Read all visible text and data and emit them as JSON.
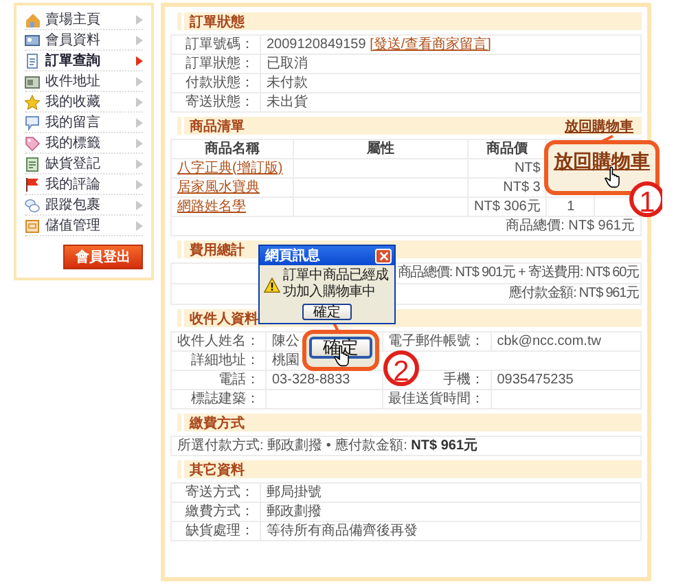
{
  "sidebar": {
    "items": [
      {
        "label": "賣場主頁",
        "selected": false
      },
      {
        "label": "會員資料",
        "selected": false
      },
      {
        "label": "訂單查詢",
        "selected": true
      },
      {
        "label": "收件地址",
        "selected": false
      },
      {
        "label": "我的收藏",
        "selected": false
      },
      {
        "label": "我的留言",
        "selected": false
      },
      {
        "label": "我的標籤",
        "selected": false
      },
      {
        "label": "缺貨登記",
        "selected": false
      },
      {
        "label": "我的評論",
        "selected": false
      },
      {
        "label": "跟蹤包裹",
        "selected": false
      },
      {
        "label": "儲值管理",
        "selected": false
      }
    ],
    "logout_button": "會員登出"
  },
  "sections": [
    {
      "kind": "fields",
      "title": "訂單狀態",
      "rows": [
        {
          "label": "訂單號碼：",
          "value": "2009120849159",
          "link": "[發送/查看商家留言]"
        },
        {
          "label": "訂單狀態：",
          "value": "已取消"
        },
        {
          "label": "付款狀態：",
          "value": "未付款"
        },
        {
          "label": "寄送狀態：",
          "value": "未出貨"
        }
      ]
    },
    {
      "kind": "products",
      "title": "商品清單",
      "action": "放回購物車",
      "columns": [
        "商品名稱",
        "屬性",
        "商品價"
      ],
      "rows": [
        {
          "name": "八字正典(增訂版)",
          "price": "NT$"
        },
        {
          "name": "居家風水寶典",
          "price": "NT$ 3"
        },
        {
          "name": "網路姓名學",
          "price": "NT$ 306元",
          "quantity": "1"
        }
      ],
      "total": "商品總價: NT$ 961元"
    },
    {
      "kind": "lines",
      "title": "費用總計",
      "lines": [
        "商品總價: NT$ 901元 + 寄送費用: NT$ 60元",
        "應付款金額: NT$ 961元"
      ]
    },
    {
      "kind": "grid",
      "title": "收件人資料",
      "rows": [
        [
          {
            "label": "收件人姓名：",
            "value": "陳公"
          },
          {
            "label": "電子郵件帳號：",
            "value": "cbk@ncc.com.tw"
          }
        ],
        [
          {
            "label": "詳細地址：",
            "value": "桃園"
          }
        ],
        [
          {
            "label": "電話：",
            "value": "03-328-8833"
          },
          {
            "label": "手機：",
            "value": "0935475235"
          }
        ],
        [
          {
            "label": "標誌建築："
          },
          {
            "label": "最佳送貨時間："
          }
        ]
      ]
    },
    {
      "kind": "text",
      "title": "繳費方式",
      "text": "所選付款方式: 郵政劃撥 • 應付款金額: **NT$ 961元**"
    },
    {
      "kind": "fields",
      "title": "其它資料",
      "rows": [
        {
          "label": "寄送方式：",
          "value": "郵局掛號"
        },
        {
          "label": "繳費方式：",
          "value": "郵政劃撥"
        },
        {
          "label": "缺貨處理：",
          "value": "等待所有商品備齊後再發"
        }
      ]
    }
  ],
  "dialog": {
    "title": "網頁訊息",
    "message": "訂單中商品已經成功加入購物車中",
    "button": "確定"
  },
  "callouts": [
    {
      "number": "1",
      "text": "放回購物車"
    },
    {
      "number": "2",
      "text": "確定"
    }
  ]
}
